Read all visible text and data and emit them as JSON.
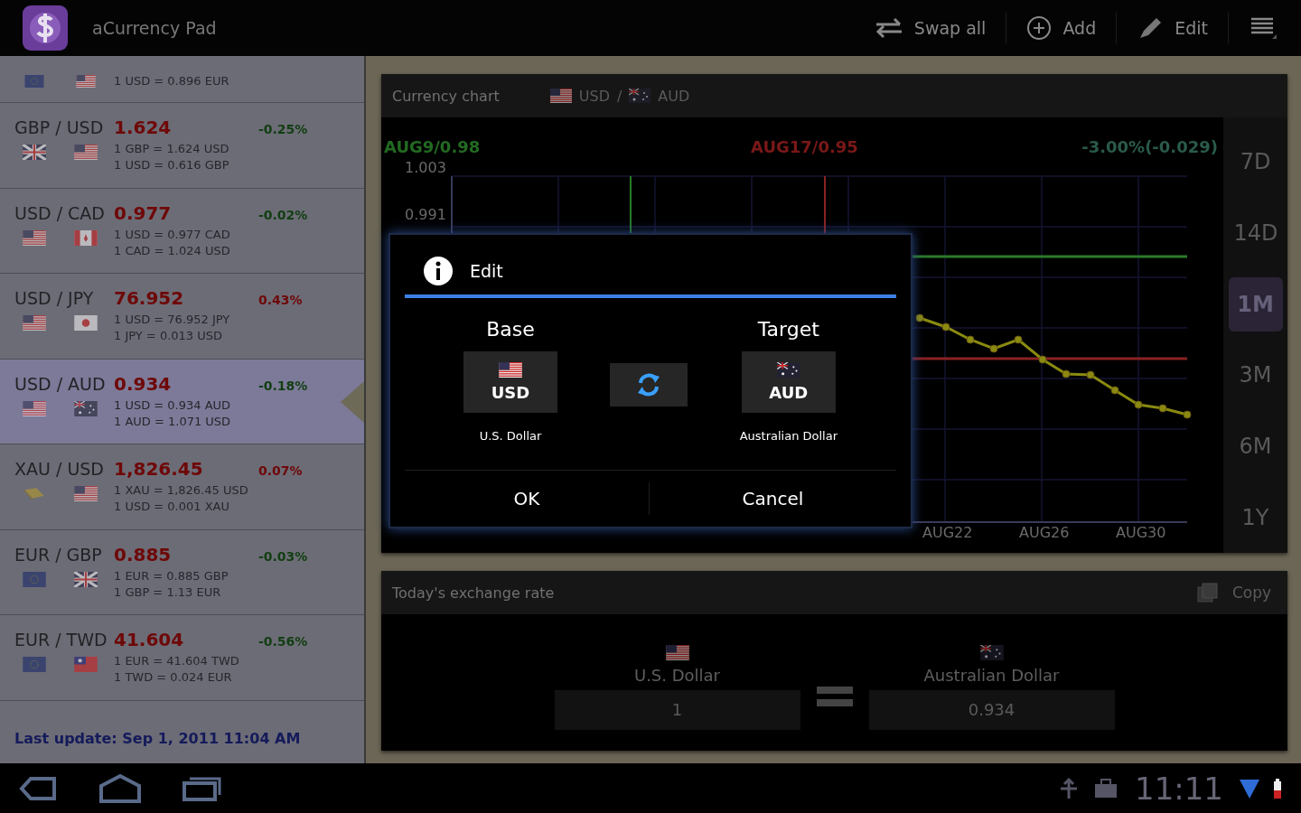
{
  "app_bar": {
    "title": "aCurrency Pad",
    "actions": [
      {
        "label": "Swap all",
        "kind": "swap"
      },
      {
        "label": "Add",
        "kind": "add"
      },
      {
        "label": "Edit",
        "kind": "edit"
      }
    ]
  },
  "pair_list": {
    "partial_item": {
      "flags": [
        {
          "kind": "eu"
        },
        {
          "kind": "us"
        }
      ],
      "line": "1 USD = 0.896 EUR"
    },
    "items": [
      {
        "pair": "GBP / USD",
        "rate": "1.624",
        "change": "-0.25%",
        "kind": "falling",
        "flags": [
          {
            "kind": "gb"
          },
          {
            "kind": "us"
          }
        ],
        "lines": [
          "1 GBP = 1.624 USD",
          "1 USD = 0.616 GBP"
        ],
        "selected": false
      },
      {
        "pair": "USD / CAD",
        "rate": "0.977",
        "change": "-0.02%",
        "kind": "falling",
        "flags": [
          {
            "kind": "us"
          },
          {
            "kind": "ca"
          }
        ],
        "lines": [
          "1 USD = 0.977 CAD",
          "1 CAD = 1.024 USD"
        ],
        "selected": false
      },
      {
        "pair": "USD / JPY",
        "rate": "76.952",
        "change": "0.43%",
        "kind": "rising",
        "flags": [
          {
            "kind": "us"
          },
          {
            "kind": "jp"
          }
        ],
        "lines": [
          "1 USD = 76.952 JPY",
          "1 JPY = 0.013 USD"
        ],
        "selected": false
      },
      {
        "pair": "USD / AUD",
        "rate": "0.934",
        "change": "-0.18%",
        "kind": "falling",
        "flags": [
          {
            "kind": "us"
          },
          {
            "kind": "au"
          }
        ],
        "lines": [
          "1 USD = 0.934 AUD",
          "1 AUD = 1.071 USD"
        ],
        "selected": true
      },
      {
        "pair": "XAU / USD",
        "rate": "1,826.45",
        "change": "0.07%",
        "kind": "rising",
        "flags": [
          {
            "kind": "xau"
          },
          {
            "kind": "us"
          }
        ],
        "lines": [
          "1 XAU = 1,826.45 USD",
          "1 USD = 0.001 XAU"
        ],
        "selected": false
      },
      {
        "pair": "EUR / GBP",
        "rate": "0.885",
        "change": "-0.03%",
        "kind": "falling",
        "flags": [
          {
            "kind": "eu"
          },
          {
            "kind": "gb"
          }
        ],
        "lines": [
          "1 EUR = 0.885 GBP",
          "1 GBP = 1.13 EUR"
        ],
        "selected": false
      },
      {
        "pair": "EUR / TWD",
        "rate": "41.604",
        "change": "-0.56%",
        "kind": "falling",
        "flags": [
          {
            "kind": "eu"
          },
          {
            "kind": "tw"
          }
        ],
        "lines": [
          "1 EUR = 41.604 TWD",
          "1 TWD = 0.024 EUR"
        ],
        "selected": false
      }
    ],
    "last_update": "Last update: Sep 1, 2011 11:04 AM"
  },
  "chart": {
    "title": "Currency chart",
    "base": "USD",
    "separator": "/",
    "target": "AUD",
    "base_flag": {
      "kind": "us"
    },
    "target_flag": {
      "kind": "au"
    },
    "high_label": "AUG9/0.98",
    "low_label": "AUG17/0.95",
    "change_label": "-3.00%(-0.029)",
    "y_ticks": [
      "1.003",
      "0.991"
    ],
    "x_ticks": [
      "AUG22",
      "AUG26",
      "AUG30"
    ],
    "ranges": [
      {
        "label": "7D",
        "selected": false
      },
      {
        "label": "14D",
        "selected": false
      },
      {
        "label": "1M",
        "selected": true
      },
      {
        "label": "3M",
        "selected": false
      },
      {
        "label": "6M",
        "selected": false
      },
      {
        "label": "1Y",
        "selected": false
      }
    ]
  },
  "dialog": {
    "title": "Edit",
    "base_heading": "Base",
    "target_heading": "Target",
    "base": {
      "code": "USD",
      "name": "U.S. Dollar",
      "flag": {
        "kind": "us"
      }
    },
    "target": {
      "code": "AUD",
      "name": "Australian Dollar",
      "flag": {
        "kind": "au"
      }
    },
    "buttons": [
      "OK",
      "Cancel"
    ]
  },
  "exchange": {
    "title": "Today's exchange rate",
    "copy": "Copy",
    "base": {
      "name": "U.S. Dollar",
      "flag": {
        "kind": "us"
      },
      "value": "1"
    },
    "target": {
      "name": "Australian Dollar",
      "flag": {
        "kind": "au"
      },
      "value": "0.934"
    }
  },
  "system_bar": {
    "time": "11:11"
  }
}
